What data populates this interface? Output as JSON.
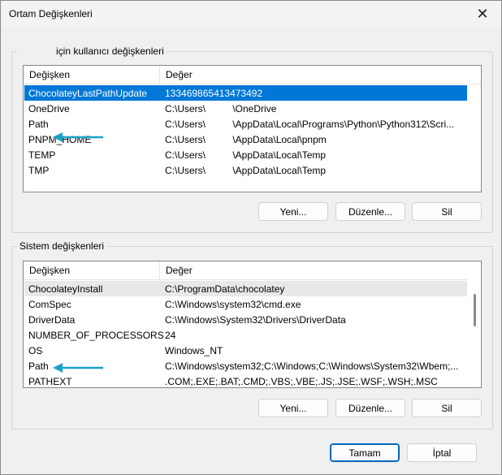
{
  "window": {
    "title": "Ortam Değişkenleri",
    "close_glyph": "✕"
  },
  "user_vars": {
    "group_title": "için kullanıcı değişkenleri",
    "col_variable": "Değişken",
    "col_value": "Değer",
    "rows": [
      {
        "name": "ChocolateyLastPathUpdate",
        "value": "133469865413473492"
      },
      {
        "name": "OneDrive",
        "value": "C:\\Users\\          \\OneDrive"
      },
      {
        "name": "Path",
        "value": "C:\\Users\\          \\AppData\\Local\\Programs\\Python\\Python312\\Scri..."
      },
      {
        "name": "PNPM_HOME",
        "value": "C:\\Users\\          \\AppData\\Local\\pnpm"
      },
      {
        "name": "TEMP",
        "value": "C:\\Users\\          \\AppData\\Local\\Temp"
      },
      {
        "name": "TMP",
        "value": "C:\\Users\\          \\AppData\\Local\\Temp"
      }
    ],
    "btn_new": "Yeni...",
    "btn_edit": "Düzenle...",
    "btn_delete": "Sil"
  },
  "system_vars": {
    "group_title": "Sistem değişkenleri",
    "col_variable": "Değişken",
    "col_value": "Değer",
    "rows": [
      {
        "name": "ChocolateyInstall",
        "value": "C:\\ProgramData\\chocolatey"
      },
      {
        "name": "ComSpec",
        "value": "C:\\Windows\\system32\\cmd.exe"
      },
      {
        "name": "DriverData",
        "value": "C:\\Windows\\System32\\Drivers\\DriverData"
      },
      {
        "name": "NUMBER_OF_PROCESSORS",
        "value": "24"
      },
      {
        "name": "OS",
        "value": "Windows_NT"
      },
      {
        "name": "Path",
        "value": "C:\\Windows\\system32;C:\\Windows;C:\\Windows\\System32\\Wbem;..."
      },
      {
        "name": "PATHEXT",
        "value": ".COM;.EXE;.BAT;.CMD;.VBS;.VBE;.JS;.JSE;.WSF;.WSH;.MSC"
      }
    ],
    "btn_new": "Yeni...",
    "btn_edit": "Düzenle...",
    "btn_delete": "Sil"
  },
  "footer": {
    "ok": "Tamam",
    "cancel": "İptal"
  },
  "colors": {
    "selection": "#0078d7",
    "arrow": "#1aa3c8"
  }
}
